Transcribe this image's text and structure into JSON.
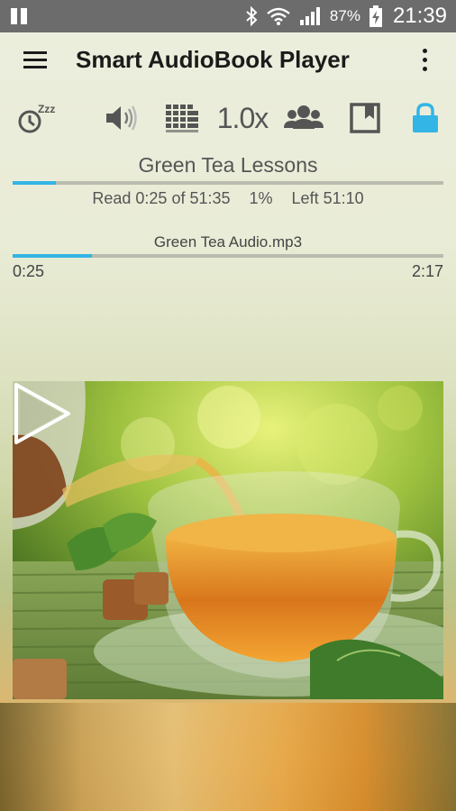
{
  "status_bar": {
    "battery_percent": "87%",
    "time": "21:39",
    "icons": [
      "pause-icon",
      "bluetooth-icon",
      "wifi-icon",
      "signal-icon",
      "battery-charging-icon"
    ]
  },
  "app_bar": {
    "title": "Smart AudioBook Player",
    "menu_icon": "hamburger-icon",
    "overflow_icon": "more-vert-icon"
  },
  "toolbar": {
    "sleep_timer_icon": "sleep-timer-icon",
    "volume_icon": "volume-icon",
    "equalizer_icon": "equalizer-icon",
    "speed_label": "1.0x",
    "characters_icon": "characters-icon",
    "bookmark_icon": "bookmark-icon",
    "lock_icon": "lock-icon",
    "lock_active_color": "#33b5e5"
  },
  "book": {
    "title": "Green Tea Lessons",
    "progress_fraction": 0.01,
    "read_text": "Read 0:25 of 51:35",
    "percent_text": "1%",
    "left_text": "Left 51:10"
  },
  "file": {
    "name": "Green Tea Audio.mp3",
    "progress_fraction": 0.184,
    "position": "0:25",
    "duration": "2:17"
  },
  "cover": {
    "play_icon": "play-icon"
  },
  "colors": {
    "accent": "#33b5e5",
    "status_bar_bg": "#6c6c6c"
  }
}
